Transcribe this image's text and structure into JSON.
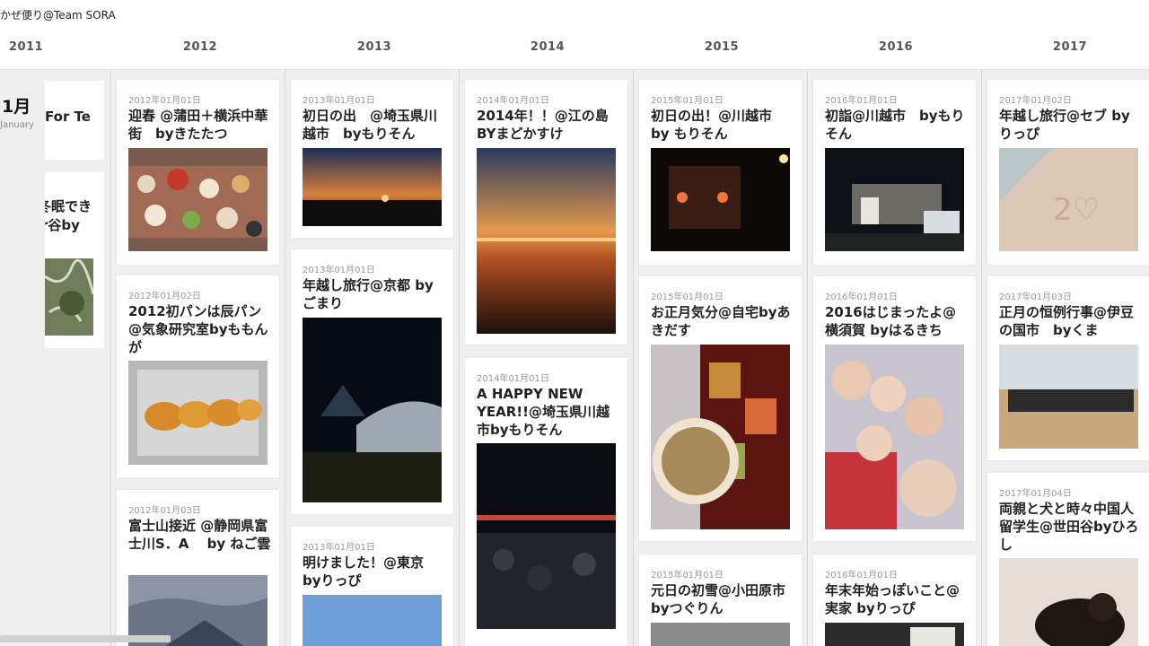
{
  "site_title": "かぜ便り@Team SORA",
  "years": [
    "2011",
    "2012",
    "2013",
    "2014",
    "2015",
    "2016",
    "2017"
  ],
  "month": {
    "label": "1月",
    "sub": "January"
  },
  "partial_2011": [
    {
      "title": "For Te"
    },
    {
      "title": "冬眠でき",
      "title2": "r谷by"
    }
  ],
  "columns": [
    {
      "year": "2012",
      "cards": [
        {
          "date": "2012年01月01日",
          "title": "迎春 @蒲田＋横浜中華街　byきたたつ",
          "image": "new-year-feast-photo"
        },
        {
          "date": "2012年01月02日",
          "title": "2012初パンは辰パン@気象研究室byももんが",
          "image": "dragon-bread-photo"
        },
        {
          "date": "2012年01月03日",
          "title": "富士山接近 @静岡県富士川S．A　 by ねご雲",
          "image": "mount-fuji-photo"
        }
      ]
    },
    {
      "year": "2013",
      "cards": [
        {
          "date": "2013年01月01日",
          "title": "初日の出　@埼玉県川越市　byもりそん",
          "image": "sunrise-photo"
        },
        {
          "date": "2013年01月01日",
          "title": "年越し旅行@京都 by ごまり",
          "image": "kyoto-night-temple-photo"
        },
        {
          "date": "2013年01月01日",
          "title": "明けました！@東京 byりっぴ",
          "image": "tokyo-sky-photo"
        }
      ]
    },
    {
      "year": "2014",
      "cards": [
        {
          "date": "2014年01月01日",
          "title": "2014年！！@江の島　BYまどかすけ",
          "image": "enoshima-sunrise-photo"
        },
        {
          "date": "2014年01月01日",
          "title": "A HAPPY NEW YEAR!!@埼玉県川越市byもりそん",
          "image": "shrine-crowd-photo"
        }
      ]
    },
    {
      "year": "2015",
      "cards": [
        {
          "date": "2015年01月01日",
          "title": "初日の出！@川越市　by もりそん",
          "image": "shrine-night-photo"
        },
        {
          "date": "2015年01月01日",
          "title": "お正月気分@自宅byあきだす",
          "image": "osechi-photo"
        },
        {
          "date": "2015年01月01日",
          "title": "元日の初雪@小田原市　byつぐりん",
          "image": "snow-photo"
        }
      ]
    },
    {
      "year": "2016",
      "cards": [
        {
          "date": "2016年01月01日",
          "title": "初詣@川越市　byもりそん",
          "image": "shrine-stage-photo"
        },
        {
          "date": "2016年01月01日",
          "title": "2016はじまったよ@横須賀 byはるきち",
          "image": "group-selfie-photo"
        },
        {
          "date": "2016年01月01日",
          "title": "年末年始っぽいこと@実家 byりっぴ",
          "image": "calligraphy-photo"
        }
      ]
    },
    {
      "year": "2017",
      "cards": [
        {
          "date": "2017年01月02日",
          "title": "年越し旅行@セブ byりっぴ",
          "image": "sand-writing-photo"
        },
        {
          "date": "2017年01月03日",
          "title": "正月の恒例行事@伊豆の国市　byくま",
          "image": "gym-group-photo"
        },
        {
          "date": "2017年01月04日",
          "title": "両親と犬と時々中国人留学生@世田谷byひろし",
          "image": "dog-photo"
        }
      ]
    }
  ]
}
